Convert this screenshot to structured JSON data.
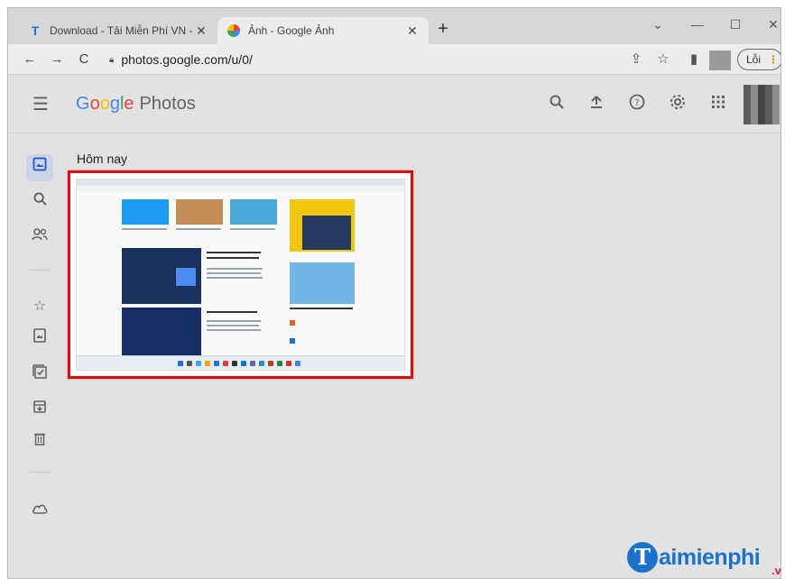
{
  "browser": {
    "tabs": [
      {
        "favicon": "T",
        "title": "Download - Tải Miễn Phí VN - Ph",
        "close": "✕"
      },
      {
        "favicon": "pinwheel-icon",
        "title": "Ảnh - Google Ảnh",
        "close": "✕"
      }
    ],
    "new_tab": "+",
    "window_controls": {
      "dropdown": "⌄",
      "minimize": "—",
      "maximize": "☐",
      "close": "✕"
    },
    "url": "photos.google.com/u/0/",
    "error_button": {
      "label": "Lỗi",
      "dots": "⋮"
    }
  },
  "app": {
    "logo": {
      "google": [
        "G",
        "o",
        "o",
        "g",
        "l",
        "e"
      ],
      "product": "Photos"
    },
    "header_icons": [
      "search-icon",
      "upload-icon",
      "help-icon",
      "settings-icon",
      "apps-icon"
    ]
  },
  "sidebar": {
    "items": [
      "photos-icon",
      "search-icon",
      "sharing-icon",
      "favorites-icon",
      "albums-icon",
      "utilities-icon",
      "archive-icon",
      "trash-icon",
      "storage-icon"
    ]
  },
  "main": {
    "section_title": "Hôm nay"
  },
  "watermark": {
    "initial": "T",
    "text": "aimienphi",
    "suffix": ".vn"
  },
  "colors": {
    "accent": "#1a56c4",
    "highlight_border": "#e00c0c",
    "brand_blue": "#1a73c9"
  }
}
